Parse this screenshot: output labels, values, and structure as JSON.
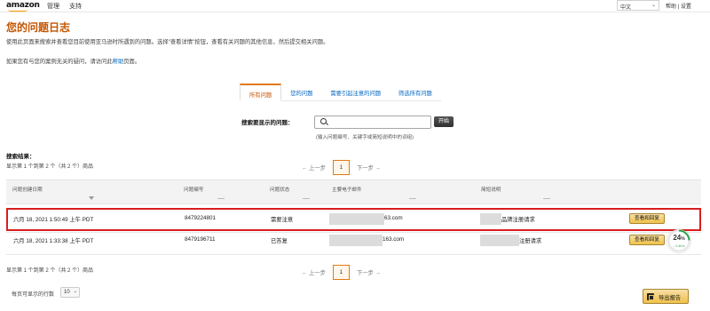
{
  "header": {
    "logo_text": "amazon",
    "nav": [
      "管理",
      "支持"
    ],
    "language": "中文",
    "help": "帮助",
    "separator": "|",
    "settings": "设置"
  },
  "page": {
    "title": "您的问题日志",
    "description": "使用此页面来搜索并查看您目前使用亚马逊时所遇到的问题。选择\"查看详情\"按钮，查看有关问题的其他信息，然后提交相关问题。",
    "help_prefix": "如果您有与您的案例无关的疑问，请访问此",
    "help_link": "帮助",
    "help_suffix": "页面。"
  },
  "tabs": [
    {
      "label": "所有问题",
      "active": true
    },
    {
      "label": "您的问题",
      "active": false
    },
    {
      "label": "需要引起注意的问题",
      "active": false
    },
    {
      "label": "筛选所有问题",
      "active": false
    }
  ],
  "search": {
    "label": "搜索要显示的问题：",
    "placeholder": "",
    "button": "开始",
    "hint": "(输入问题编号、关键字或简短说明中的词组)"
  },
  "results": {
    "label": "搜索结果：",
    "count_text": "显示第 1 个到第 2 个（共 2 个）商品",
    "count_text_bottom": "显示第 1 个到第 2 个（共 2 个）商品"
  },
  "pager": {
    "prev": "← 上一步",
    "current": "1",
    "next": "下一步 →"
  },
  "table": {
    "columns": [
      "问题创建日期",
      "问题编号",
      "问题状态",
      "主要电子邮件",
      "简短说明"
    ],
    "rows": [
      {
        "date": "六月 18, 2021 1:50:49 上午 PDT",
        "number": "8479224801",
        "status": "需要注意",
        "email_suffix": "63.com",
        "description_suffix": "品牌注册请求",
        "action": "查看和回复",
        "highlighted": true
      },
      {
        "date": "六月 18, 2021 1:33:38 上午 PDT",
        "number": "8479196711",
        "status": "已答复",
        "email_suffix": "163.com",
        "description_suffix": "注册请求",
        "action": "查看和回复",
        "highlighted": false
      }
    ]
  },
  "progress": {
    "value": 24,
    "unit": "%",
    "rate": "↓ 0.4K/s",
    "color": "#2aa34a"
  },
  "footer": {
    "rows_per_page_label": "每页可显示的行数",
    "rows_per_page_value": "10",
    "export_button": "导出报告"
  },
  "colors": {
    "title": "#c45500",
    "link": "#0066c0",
    "highlight_border": "#d81e1e",
    "button_yellow": "#f0c14b",
    "tab_active_top": "#e47911"
  }
}
